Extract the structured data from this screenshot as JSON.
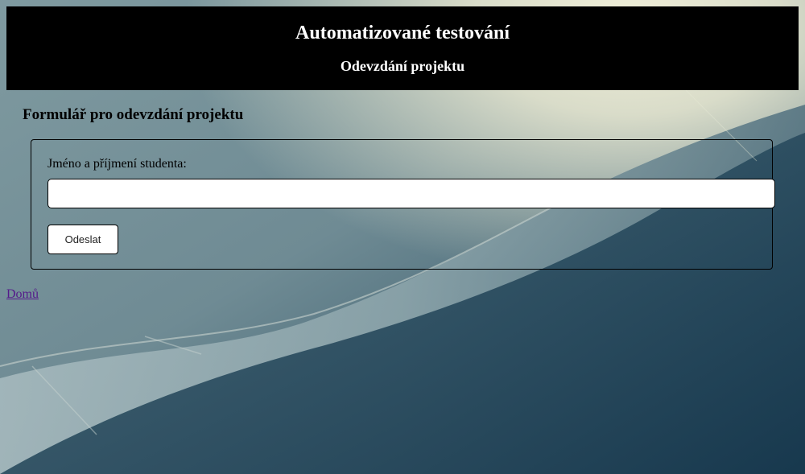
{
  "header": {
    "title": "Automatizované testování",
    "subtitle": "Odevzdání projektu"
  },
  "form": {
    "title": "Formulář pro odevzdání projektu",
    "student_name_label": "Jméno a příjmení studenta:",
    "student_name_value": "",
    "submit_label": "Odeslat"
  },
  "nav": {
    "home_link": "Domů"
  },
  "colors": {
    "header_bg": "#000000",
    "header_text": "#ffffff",
    "visited_link": "#551a8b"
  }
}
